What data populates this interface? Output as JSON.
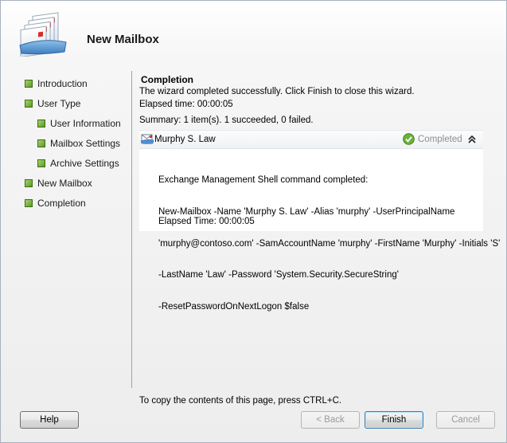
{
  "wizard": {
    "title": "New Mailbox"
  },
  "nav": {
    "items": [
      {
        "label": "Introduction",
        "level": 0
      },
      {
        "label": "User Type",
        "level": 0
      },
      {
        "label": "User Information",
        "level": 1
      },
      {
        "label": "Mailbox Settings",
        "level": 1
      },
      {
        "label": "Archive Settings",
        "level": 1
      },
      {
        "label": "New Mailbox",
        "level": 0
      },
      {
        "label": "Completion",
        "level": 0
      }
    ]
  },
  "content": {
    "heading": "Completion",
    "message": "The wizard completed successfully. Click Finish to close this wizard.",
    "elapsed": "Elapsed time: 00:00:05",
    "summary": "Summary: 1 item(s). 1 succeeded, 0 failed."
  },
  "result": {
    "name": "Murphy S. Law",
    "status": "Completed",
    "command_lines": [
      "Exchange Management Shell command completed:",
      "New-Mailbox -Name 'Murphy S. Law' -Alias 'murphy' -UserPrincipalName",
      "'murphy@contoso.com' -SamAccountName 'murphy' -FirstName 'Murphy' -Initials 'S'",
      "-LastName 'Law' -Password 'System.Security.SecureString'",
      "-ResetPasswordOnNextLogon $false"
    ],
    "elapsed": "Elapsed Time: 00:00:05"
  },
  "footer": {
    "copy_hint": "To copy the contents of this page, press CTRL+C.",
    "help_label": "Help",
    "back_label": "< Back",
    "finish_label": "Finish",
    "cancel_label": "Cancel"
  },
  "colors": {
    "bullet_green": "#6aaa2e",
    "status_gray": "#8e8e8e",
    "accent_blue": "#3c7fb1"
  }
}
